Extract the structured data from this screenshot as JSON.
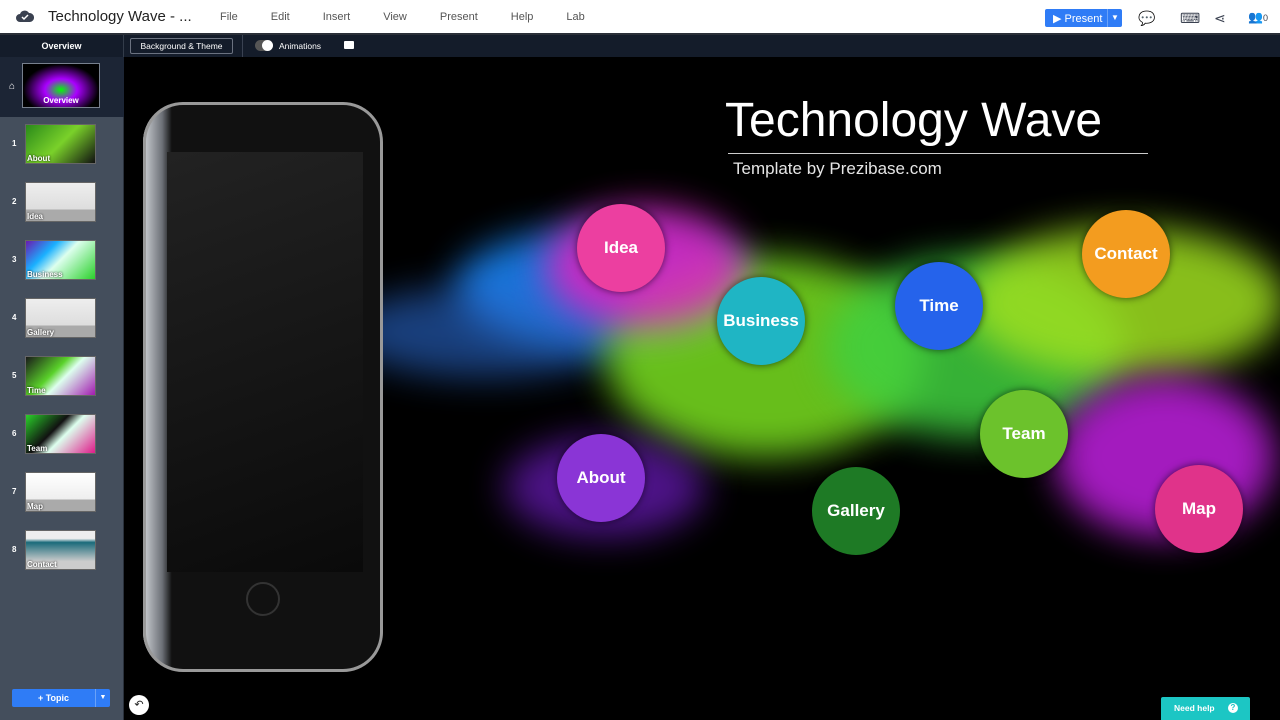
{
  "header": {
    "title": "Technology Wave - ...",
    "menu": [
      "File",
      "Edit",
      "Insert",
      "View",
      "Present",
      "Help",
      "Lab"
    ],
    "present_label": "Present",
    "collaborators_count": "0"
  },
  "toolbar": {
    "overview": "Overview",
    "background_theme": "Background & Theme",
    "animations": "Animations"
  },
  "sidebar": {
    "overview_label": "Overview",
    "slides": [
      {
        "num": "1",
        "label": "About",
        "bg": "linear-gradient(135deg,#2a8a1a,#7ad12a 50%,#111)"
      },
      {
        "num": "2",
        "label": "Idea",
        "bg": "linear-gradient(#eee,#ddd 70%,#aaa 70%)"
      },
      {
        "num": "3",
        "label": "Business",
        "bg": "linear-gradient(135deg,#6a1ab0,#1ab0ff 30%,#dfe 50%,#2ad12a)"
      },
      {
        "num": "4",
        "label": "Gallery",
        "bg": "linear-gradient(#eee,#ddd 70%,#aaa 70%)"
      },
      {
        "num": "5",
        "label": "Time",
        "bg": "linear-gradient(135deg,#1a1a1a,#5ad12a 40%,#dfe 55%,#a21ab0)"
      },
      {
        "num": "6",
        "label": "Team",
        "bg": "linear-gradient(135deg,#2ad12a,#111 40%,#dfe 55%,#e01a8a)"
      },
      {
        "num": "7",
        "label": "Map",
        "bg": "linear-gradient(#fff,#eee 70%,#aaa 70%)"
      },
      {
        "num": "8",
        "label": "Contact",
        "bg": "linear-gradient(#eee 20%,#1a6a7a 30%,#ccc 80%)"
      }
    ],
    "topic_label": "Topic"
  },
  "canvas": {
    "title": "Technology Wave",
    "subtitle": "Template by Prezibase.com",
    "bubbles": [
      {
        "label": "Idea",
        "color": "#ec3fa0"
      },
      {
        "label": "Business",
        "color": "#1fb5c4"
      },
      {
        "label": "Time",
        "color": "#2563eb"
      },
      {
        "label": "Contact",
        "color": "#f39c1f"
      },
      {
        "label": "About",
        "color": "#8a35d6"
      },
      {
        "label": "Gallery",
        "color": "#1e7a25"
      },
      {
        "label": "Team",
        "color": "#6cc22c"
      },
      {
        "label": "Map",
        "color": "#e0338a"
      }
    ]
  },
  "help": {
    "label": "Need help"
  },
  "colors": {
    "accent": "#2f7cf6",
    "help": "#1cc6c4"
  }
}
